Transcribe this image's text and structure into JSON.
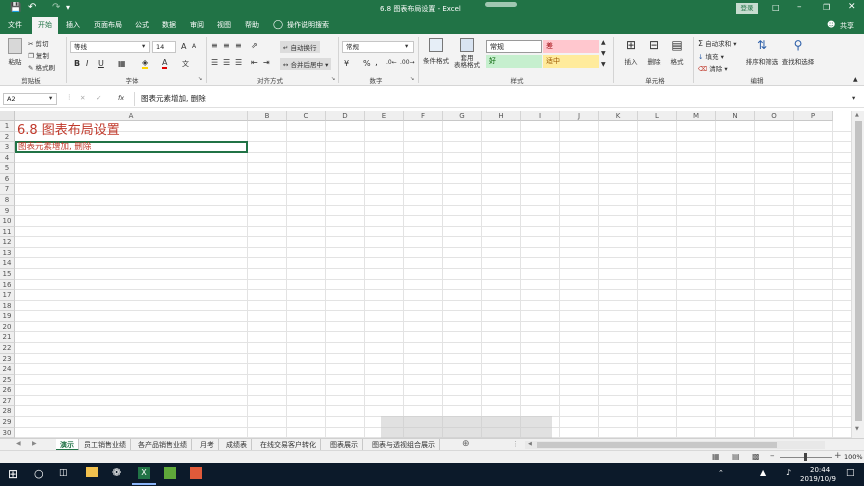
{
  "window": {
    "title": "6.8 图表布局设置 - Excel",
    "login": "登录",
    "share": "共享"
  },
  "tabs": [
    "文件",
    "开始",
    "插入",
    "页面布局",
    "公式",
    "数据",
    "审阅",
    "视图",
    "帮助",
    "操作说明搜索"
  ],
  "ribbon": {
    "clipboard": {
      "paste": "粘贴",
      "cut": "剪切",
      "copy": "复制",
      "format_painter": "格式刷",
      "label": "剪贴板"
    },
    "font": {
      "name": "等线",
      "size": "14",
      "label": "字体",
      "bold": "B",
      "italic": "I",
      "underline": "U",
      "grow": "A",
      "shrink": "A"
    },
    "alignment": {
      "wrap": "自动换行",
      "merge": "合并后居中",
      "label": "对齐方式"
    },
    "number": {
      "format": "常规",
      "label": "数字",
      "percent": "%",
      "comma": ","
    },
    "styles": {
      "conditional": "条件格式",
      "table": "套用\n表格格式",
      "s1": "常规",
      "s2": "差",
      "s3": "好",
      "s4": "适中",
      "label": "样式"
    },
    "cells": {
      "insert": "插入",
      "delete": "删除",
      "format": "格式",
      "label": "单元格"
    },
    "editing": {
      "autosum": "自动求和",
      "fill": "填充",
      "clear": "清除",
      "sort": "排序和筛选",
      "find": "查找和选择",
      "label": "编辑"
    }
  },
  "formula_bar": {
    "name_box": "A2",
    "fx": "fx",
    "content": "图表元素增加, 删除"
  },
  "columns": [
    "A",
    "B",
    "C",
    "D",
    "E",
    "F",
    "G",
    "H",
    "I",
    "J",
    "K",
    "L",
    "M",
    "N",
    "O",
    "P"
  ],
  "rows": [
    "1",
    "2",
    "3",
    "4",
    "5",
    "6",
    "7",
    "8",
    "9",
    "10",
    "11",
    "12",
    "13",
    "14",
    "15",
    "16",
    "17",
    "18",
    "19",
    "20",
    "21",
    "22",
    "23",
    "24",
    "25",
    "26",
    "27",
    "28",
    "29",
    "30"
  ],
  "cells": {
    "a1": "6.8 图表布局设置",
    "a2": "图表元素增加, 删除"
  },
  "sheet_tabs": [
    "演示",
    "员工销售业绩",
    "各产品销售业绩",
    "月考",
    "成绩表",
    "在线交易客户转化",
    "图表展示",
    "图表与透视组合展示"
  ],
  "status": {
    "zoom": "100%"
  },
  "taskbar": {
    "time": "20:44",
    "date": "2019/10/9"
  },
  "colors": {
    "brand": "#217346",
    "accent_text": "#c0392b"
  }
}
